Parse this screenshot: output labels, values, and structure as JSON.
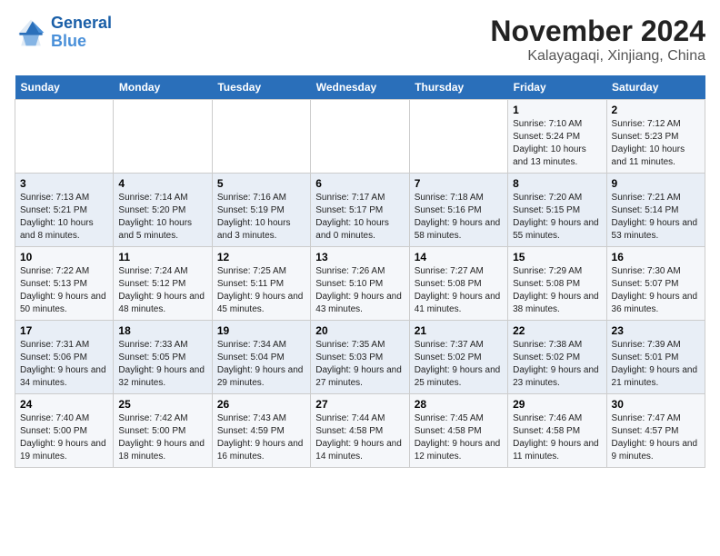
{
  "logo": {
    "line1": "General",
    "line2": "Blue"
  },
  "title": "November 2024",
  "subtitle": "Kalayagaqi, Xinjiang, China",
  "weekdays": [
    "Sunday",
    "Monday",
    "Tuesday",
    "Wednesday",
    "Thursday",
    "Friday",
    "Saturday"
  ],
  "weeks": [
    [
      {
        "day": "",
        "info": ""
      },
      {
        "day": "",
        "info": ""
      },
      {
        "day": "",
        "info": ""
      },
      {
        "day": "",
        "info": ""
      },
      {
        "day": "",
        "info": ""
      },
      {
        "day": "1",
        "info": "Sunrise: 7:10 AM\nSunset: 5:24 PM\nDaylight: 10 hours and 13 minutes."
      },
      {
        "day": "2",
        "info": "Sunrise: 7:12 AM\nSunset: 5:23 PM\nDaylight: 10 hours and 11 minutes."
      }
    ],
    [
      {
        "day": "3",
        "info": "Sunrise: 7:13 AM\nSunset: 5:21 PM\nDaylight: 10 hours and 8 minutes."
      },
      {
        "day": "4",
        "info": "Sunrise: 7:14 AM\nSunset: 5:20 PM\nDaylight: 10 hours and 5 minutes."
      },
      {
        "day": "5",
        "info": "Sunrise: 7:16 AM\nSunset: 5:19 PM\nDaylight: 10 hours and 3 minutes."
      },
      {
        "day": "6",
        "info": "Sunrise: 7:17 AM\nSunset: 5:17 PM\nDaylight: 10 hours and 0 minutes."
      },
      {
        "day": "7",
        "info": "Sunrise: 7:18 AM\nSunset: 5:16 PM\nDaylight: 9 hours and 58 minutes."
      },
      {
        "day": "8",
        "info": "Sunrise: 7:20 AM\nSunset: 5:15 PM\nDaylight: 9 hours and 55 minutes."
      },
      {
        "day": "9",
        "info": "Sunrise: 7:21 AM\nSunset: 5:14 PM\nDaylight: 9 hours and 53 minutes."
      }
    ],
    [
      {
        "day": "10",
        "info": "Sunrise: 7:22 AM\nSunset: 5:13 PM\nDaylight: 9 hours and 50 minutes."
      },
      {
        "day": "11",
        "info": "Sunrise: 7:24 AM\nSunset: 5:12 PM\nDaylight: 9 hours and 48 minutes."
      },
      {
        "day": "12",
        "info": "Sunrise: 7:25 AM\nSunset: 5:11 PM\nDaylight: 9 hours and 45 minutes."
      },
      {
        "day": "13",
        "info": "Sunrise: 7:26 AM\nSunset: 5:10 PM\nDaylight: 9 hours and 43 minutes."
      },
      {
        "day": "14",
        "info": "Sunrise: 7:27 AM\nSunset: 5:08 PM\nDaylight: 9 hours and 41 minutes."
      },
      {
        "day": "15",
        "info": "Sunrise: 7:29 AM\nSunset: 5:08 PM\nDaylight: 9 hours and 38 minutes."
      },
      {
        "day": "16",
        "info": "Sunrise: 7:30 AM\nSunset: 5:07 PM\nDaylight: 9 hours and 36 minutes."
      }
    ],
    [
      {
        "day": "17",
        "info": "Sunrise: 7:31 AM\nSunset: 5:06 PM\nDaylight: 9 hours and 34 minutes."
      },
      {
        "day": "18",
        "info": "Sunrise: 7:33 AM\nSunset: 5:05 PM\nDaylight: 9 hours and 32 minutes."
      },
      {
        "day": "19",
        "info": "Sunrise: 7:34 AM\nSunset: 5:04 PM\nDaylight: 9 hours and 29 minutes."
      },
      {
        "day": "20",
        "info": "Sunrise: 7:35 AM\nSunset: 5:03 PM\nDaylight: 9 hours and 27 minutes."
      },
      {
        "day": "21",
        "info": "Sunrise: 7:37 AM\nSunset: 5:02 PM\nDaylight: 9 hours and 25 minutes."
      },
      {
        "day": "22",
        "info": "Sunrise: 7:38 AM\nSunset: 5:02 PM\nDaylight: 9 hours and 23 minutes."
      },
      {
        "day": "23",
        "info": "Sunrise: 7:39 AM\nSunset: 5:01 PM\nDaylight: 9 hours and 21 minutes."
      }
    ],
    [
      {
        "day": "24",
        "info": "Sunrise: 7:40 AM\nSunset: 5:00 PM\nDaylight: 9 hours and 19 minutes."
      },
      {
        "day": "25",
        "info": "Sunrise: 7:42 AM\nSunset: 5:00 PM\nDaylight: 9 hours and 18 minutes."
      },
      {
        "day": "26",
        "info": "Sunrise: 7:43 AM\nSunset: 4:59 PM\nDaylight: 9 hours and 16 minutes."
      },
      {
        "day": "27",
        "info": "Sunrise: 7:44 AM\nSunset: 4:58 PM\nDaylight: 9 hours and 14 minutes."
      },
      {
        "day": "28",
        "info": "Sunrise: 7:45 AM\nSunset: 4:58 PM\nDaylight: 9 hours and 12 minutes."
      },
      {
        "day": "29",
        "info": "Sunrise: 7:46 AM\nSunset: 4:58 PM\nDaylight: 9 hours and 11 minutes."
      },
      {
        "day": "30",
        "info": "Sunrise: 7:47 AM\nSunset: 4:57 PM\nDaylight: 9 hours and 9 minutes."
      }
    ]
  ]
}
